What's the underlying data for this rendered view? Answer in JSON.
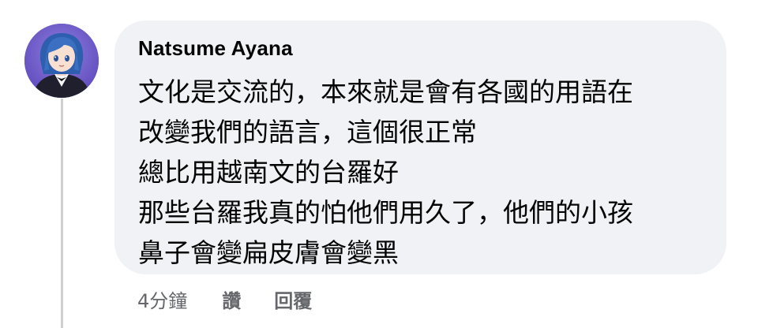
{
  "comment": {
    "author": "Natsume Ayana",
    "lines": [
      "文化是交流的，本來就是會有各國的用語在",
      "改變我們的語言，這個很正常",
      "總比用越南文的台羅好",
      "那些台羅我真的怕他們用久了，他們的小孩",
      "鼻子會變扁皮膚會變黑"
    ],
    "timestamp": "4分鐘",
    "like_label": "讚",
    "reply_label": "回覆"
  },
  "colors": {
    "bubble": "#f0f2f5",
    "text": "#050505",
    "meta": "#65676b",
    "thread_line": "#ced0d4"
  },
  "icons": {
    "avatar": "anime-character-avatar"
  }
}
